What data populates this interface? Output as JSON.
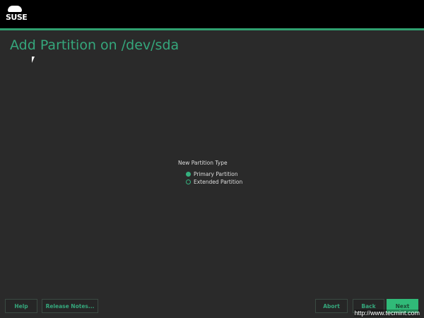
{
  "header": {
    "logo": "SUSE"
  },
  "title": "Add Partition on /dev/sda",
  "partition_type": {
    "label": "New Partition Type",
    "options": [
      {
        "label": "Primary Partition",
        "selected": true
      },
      {
        "label": "Extended Partition",
        "selected": false
      }
    ]
  },
  "buttons": {
    "help": "Help",
    "release_notes": "Release Notes...",
    "abort": "Abort",
    "back": "Back",
    "next": "Next"
  },
  "watermark": "http://www.tecmint.com",
  "colors": {
    "accent": "#30ba78",
    "background": "#2a2a2a",
    "header": "#000000"
  }
}
